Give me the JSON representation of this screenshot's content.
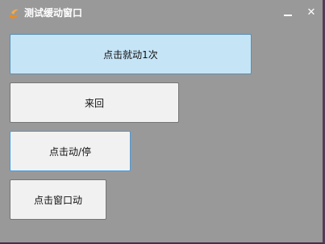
{
  "window": {
    "title": "测试缓动窗口",
    "minimize_glyph": "",
    "close_glyph": "✕",
    "icon": "app-logo-icon"
  },
  "buttons": [
    {
      "label": "点击就动1次"
    },
    {
      "label": "来回"
    },
    {
      "label": "点击动/停"
    },
    {
      "label": "点击窗口动"
    }
  ],
  "colors": {
    "window_bg": "#999999",
    "hover_button_bg": "#c5e4f6",
    "button_bg": "#f1f1f1",
    "focus_border": "#4a9ad8",
    "icon_orange": "#f08a1c"
  }
}
